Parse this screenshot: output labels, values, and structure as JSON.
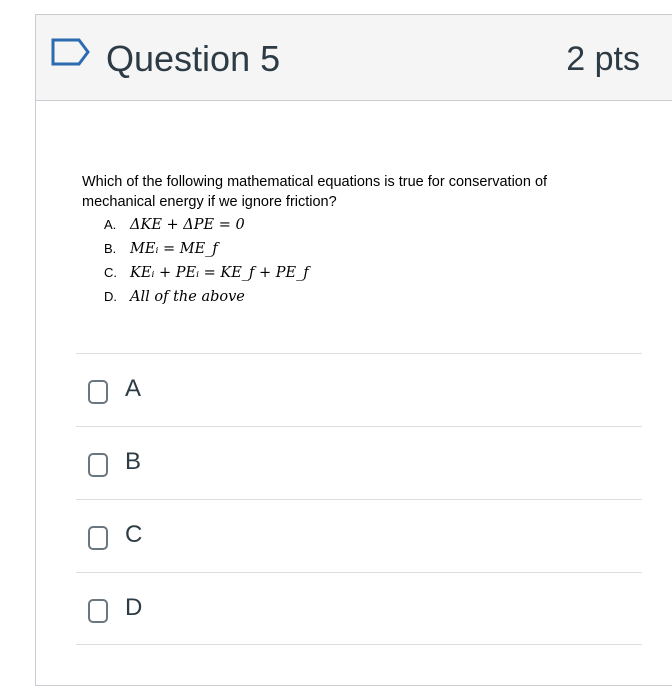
{
  "header": {
    "title": "Question 5",
    "points": "2 pts",
    "flag_icon": "bookmark-flag-icon"
  },
  "question": {
    "text": "Which of the following mathematical equations is true for conservation of mechanical energy if we ignore friction?",
    "options": [
      {
        "letter": "A.",
        "equation": "ΔKE + ΔPE = 0"
      },
      {
        "letter": "B.",
        "equation": "MEᵢ = ME_f"
      },
      {
        "letter": "C.",
        "equation": "KEᵢ + PEᵢ = KE_f + PE_f"
      },
      {
        "letter": "D.",
        "equation": "All of the above"
      }
    ]
  },
  "answers": [
    {
      "label": "A"
    },
    {
      "label": "B"
    },
    {
      "label": "C"
    },
    {
      "label": "D"
    }
  ],
  "colors": {
    "header_bg": "#f5f5f5",
    "border": "#c7cdd1",
    "text": "#2d3b45",
    "flag_stroke": "#2b6cb0"
  }
}
